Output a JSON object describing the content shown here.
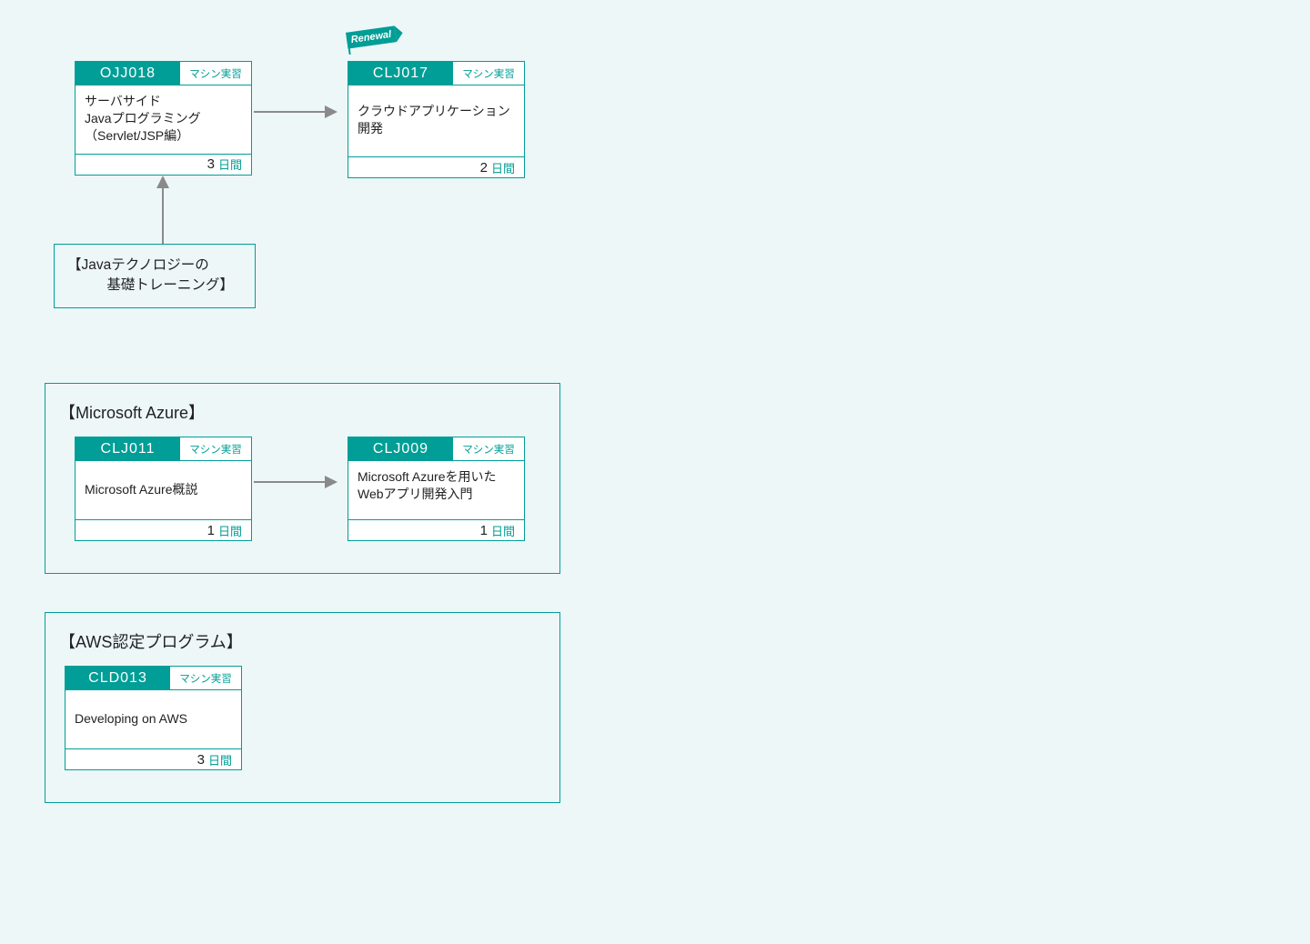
{
  "labels": {
    "machine_practice": "マシン実習",
    "days_unit": "日間",
    "renewal": "Renewal"
  },
  "top_row": {
    "c1": {
      "code": "OJJ018",
      "title_l1": "サーバサイド",
      "title_l2": "Javaプログラミング",
      "title_l3": "（Servlet/JSP編）",
      "days": "3"
    },
    "c2": {
      "code": "CLJ017",
      "title": "クラウドアプリケーション開発",
      "days": "2"
    }
  },
  "prereq": {
    "l1": "【Javaテクノロジーの",
    "l2": "基礎トレーニング】"
  },
  "groups": {
    "azure": {
      "title": "【Microsoft Azure】",
      "c1": {
        "code": "CLJ011",
        "title": "Microsoft Azure概説",
        "days": "1"
      },
      "c2": {
        "code": "CLJ009",
        "title_l1": "Microsoft Azureを用いた",
        "title_l2": "Webアプリ開発入門",
        "days": "1"
      }
    },
    "aws": {
      "title": "【AWS認定プログラム】",
      "c1": {
        "code": "CLD013",
        "title": "Developing on AWS",
        "days": "3"
      }
    }
  }
}
